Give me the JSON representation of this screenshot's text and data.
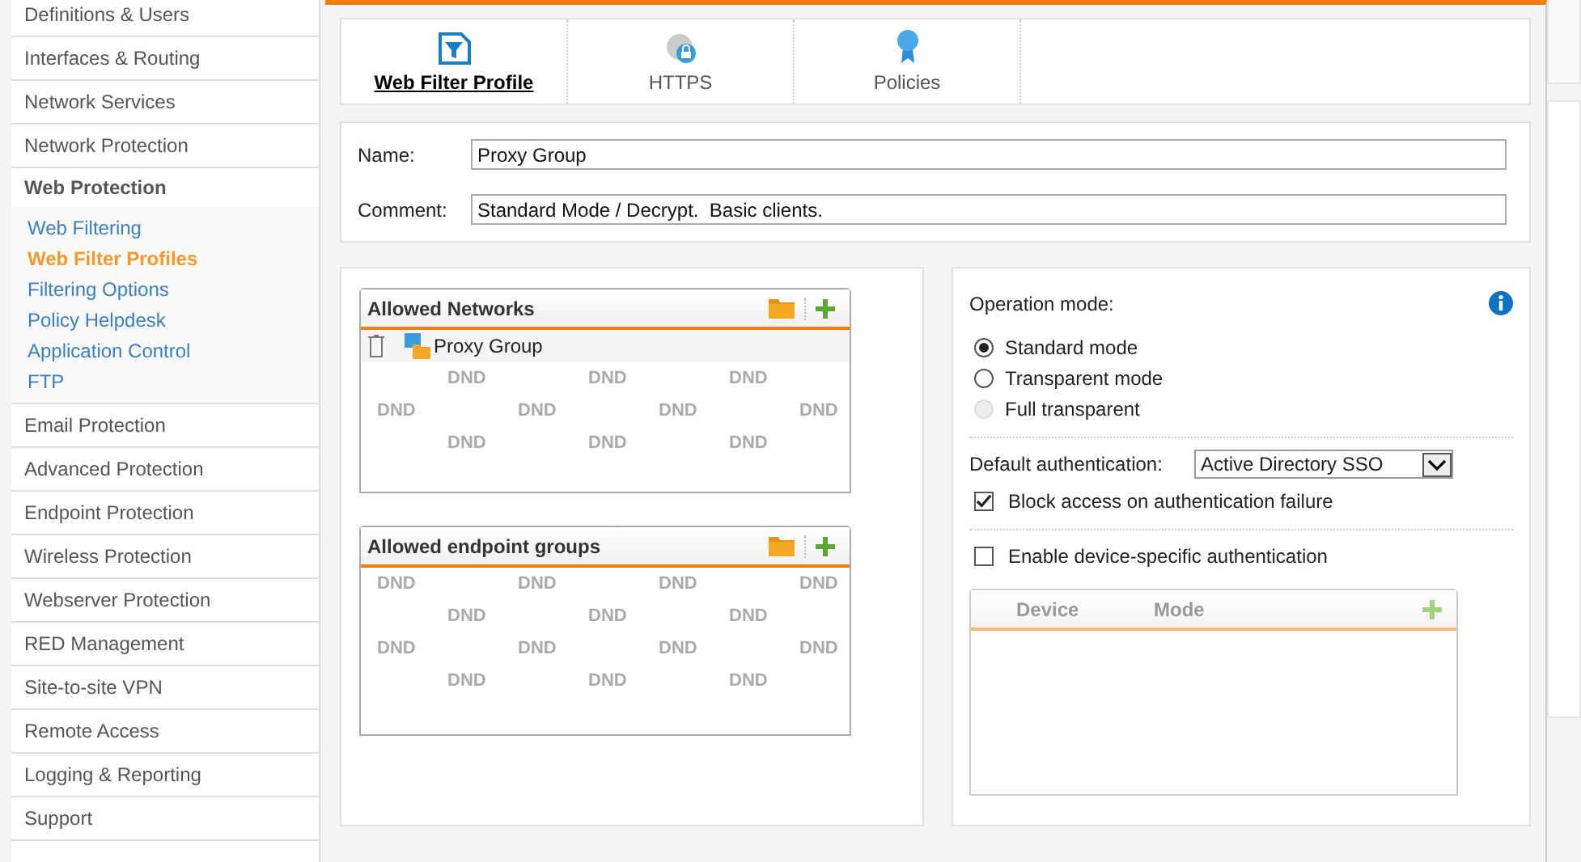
{
  "sidebar": {
    "items": [
      {
        "label": "Definitions & Users",
        "expanded": false
      },
      {
        "label": "Interfaces & Routing",
        "expanded": false
      },
      {
        "label": "Network Services",
        "expanded": false
      },
      {
        "label": "Network Protection",
        "expanded": false
      },
      {
        "label": "Web Protection",
        "expanded": true,
        "children": [
          {
            "label": "Web Filtering",
            "selected": false
          },
          {
            "label": "Web Filter Profiles",
            "selected": true
          },
          {
            "label": "Filtering Options",
            "selected": false
          },
          {
            "label": "Policy Helpdesk",
            "selected": false
          },
          {
            "label": "Application Control",
            "selected": false
          },
          {
            "label": "FTP",
            "selected": false
          }
        ]
      },
      {
        "label": "Email Protection",
        "expanded": false
      },
      {
        "label": "Advanced Protection",
        "expanded": false
      },
      {
        "label": "Endpoint Protection",
        "expanded": false
      },
      {
        "label": "Wireless Protection",
        "expanded": false
      },
      {
        "label": "Webserver Protection",
        "expanded": false
      },
      {
        "label": "RED Management",
        "expanded": false
      },
      {
        "label": "Site-to-site VPN",
        "expanded": false
      },
      {
        "label": "Remote Access",
        "expanded": false
      },
      {
        "label": "Logging & Reporting",
        "expanded": false
      },
      {
        "label": "Support",
        "expanded": false
      }
    ]
  },
  "tabs": [
    {
      "label": "Web Filter Profile",
      "kind": "filter",
      "selected": true
    },
    {
      "label": "HTTPS",
      "kind": "lock",
      "selected": false
    },
    {
      "label": "Policies",
      "kind": "ribbon",
      "selected": false
    }
  ],
  "form": {
    "name": {
      "label": "Name:",
      "value": "Proxy Group"
    },
    "comment": {
      "label": "Comment:",
      "value": "Standard Mode / Decrypt.  Basic clients."
    }
  },
  "allowed_networks": {
    "title": "Allowed Networks",
    "items": [
      {
        "label": "Proxy Group"
      }
    ],
    "watermark": [
      "DND",
      "DND",
      "DND",
      "DND",
      "DND",
      "DND",
      "DND",
      "DND",
      "DND",
      "DND"
    ]
  },
  "allowed_endpoint_groups": {
    "title": "Allowed endpoint groups",
    "watermark": [
      "DND",
      "DND",
      "DND",
      "DND",
      "DND",
      "DND",
      "DND",
      "DND",
      "DND",
      "DND",
      "DND",
      "DND",
      "DND",
      "DND"
    ]
  },
  "operation_mode": {
    "label": "Operation mode:",
    "options": [
      {
        "label": "Standard mode",
        "selected": true,
        "disabled": false
      },
      {
        "label": "Transparent mode",
        "selected": false,
        "disabled": false
      },
      {
        "label": "Full transparent",
        "selected": false,
        "disabled": true
      }
    ]
  },
  "default_authentication": {
    "label": "Default authentication:",
    "value": "Active Directory SSO"
  },
  "block_access": {
    "label": "Block access on authentication failure",
    "checked": true
  },
  "device_specific": {
    "label": "Enable device-specific authentication",
    "checked": false
  },
  "device_table": {
    "columns": [
      "Device",
      "Mode"
    ]
  }
}
